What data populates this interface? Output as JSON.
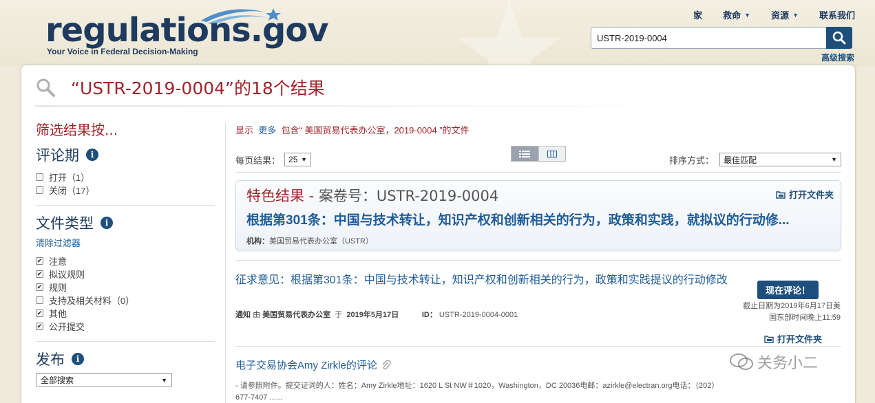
{
  "header": {
    "logo_text": "regulations",
    "logo_suffix": ".gov",
    "tagline": "Your Voice in Federal Decision-Making",
    "nav": [
      {
        "label": "家",
        "has_caret": false
      },
      {
        "label": "救命",
        "has_caret": true
      },
      {
        "label": "资源",
        "has_caret": true
      },
      {
        "label": "联系我们",
        "has_caret": false
      }
    ],
    "search_value": "USTR-2019-0004",
    "advanced_search": "高级搜索"
  },
  "results": {
    "title": "“USTR-2019-0004”的18个结果"
  },
  "sidebar": {
    "filter_title": "筛选结果按...",
    "comment_period": {
      "heading": "评论期",
      "options": [
        {
          "label": "打开（1）",
          "checked": false
        },
        {
          "label": "关闭（17）",
          "checked": false
        }
      ]
    },
    "doc_type": {
      "heading": "文件类型",
      "clear": "清除过滤器",
      "options": [
        {
          "label": "注意",
          "checked": true
        },
        {
          "label": "拟议规则",
          "checked": true
        },
        {
          "label": "规则",
          "checked": true
        },
        {
          "label": "支持及相关材料（0）",
          "checked": false
        },
        {
          "label": "其他",
          "checked": true
        },
        {
          "label": "公开提交",
          "checked": true
        }
      ]
    },
    "posted": {
      "heading": "发布",
      "select_value": "全部搜索"
    }
  },
  "content": {
    "show_more": {
      "prefix": "显示",
      "link": "更多",
      "suffix": "包含“ 美国贸易代表办公室，2019-0004 ”的文件"
    },
    "per_page_label": "每页结果：",
    "per_page_value": "25",
    "sort_label": "排序方式：",
    "sort_value": "最佳匹配",
    "featured": {
      "label": "特色结果",
      "dash": " - ",
      "docket": "案卷号：USTR-2019-0004",
      "open_folder": "打开文件夹",
      "title": "根据第301条：中国与技术转让，知识产权和创新相关的行为，政策和实践，就拟议的行动修...",
      "agency_label": "机构：",
      "agency": "美国贸易代表办公室（USTR）"
    },
    "doc1": {
      "title": "征求意见：根据第301条：中国与技术转让，知识产权和创新相关的行为，政策和实践提议的行动修改",
      "type": "通知",
      "by": "由",
      "agency": "美国贸易代表办公室",
      "on": "于",
      "date": "2019年5月17日",
      "id_label": "ID：",
      "id": "USTR-2019-0004-0001",
      "comment_btn": "现在评论！",
      "deadline_line1": "截止日期为2019年6月17日美",
      "deadline_line2": "国东部时间晚上11:59",
      "open_folder": "打开文件夹"
    },
    "doc2": {
      "title": "电子交易协会Amy Zirkle的评论",
      "body": "- 请参照附件。提交证词的人：姓名：Amy Zirkle地址：1620 L St NW＃1020，Washington，DC 20036电邮：azirkle@electran.org电话：（202）677-7407 ......"
    }
  },
  "watermark": "关务小二",
  "colors": {
    "brand_navy": "#1e3a5f",
    "accent_red": "#a1242b",
    "link_blue": "#1f5c9a",
    "button_blue": "#1e4f7c"
  }
}
